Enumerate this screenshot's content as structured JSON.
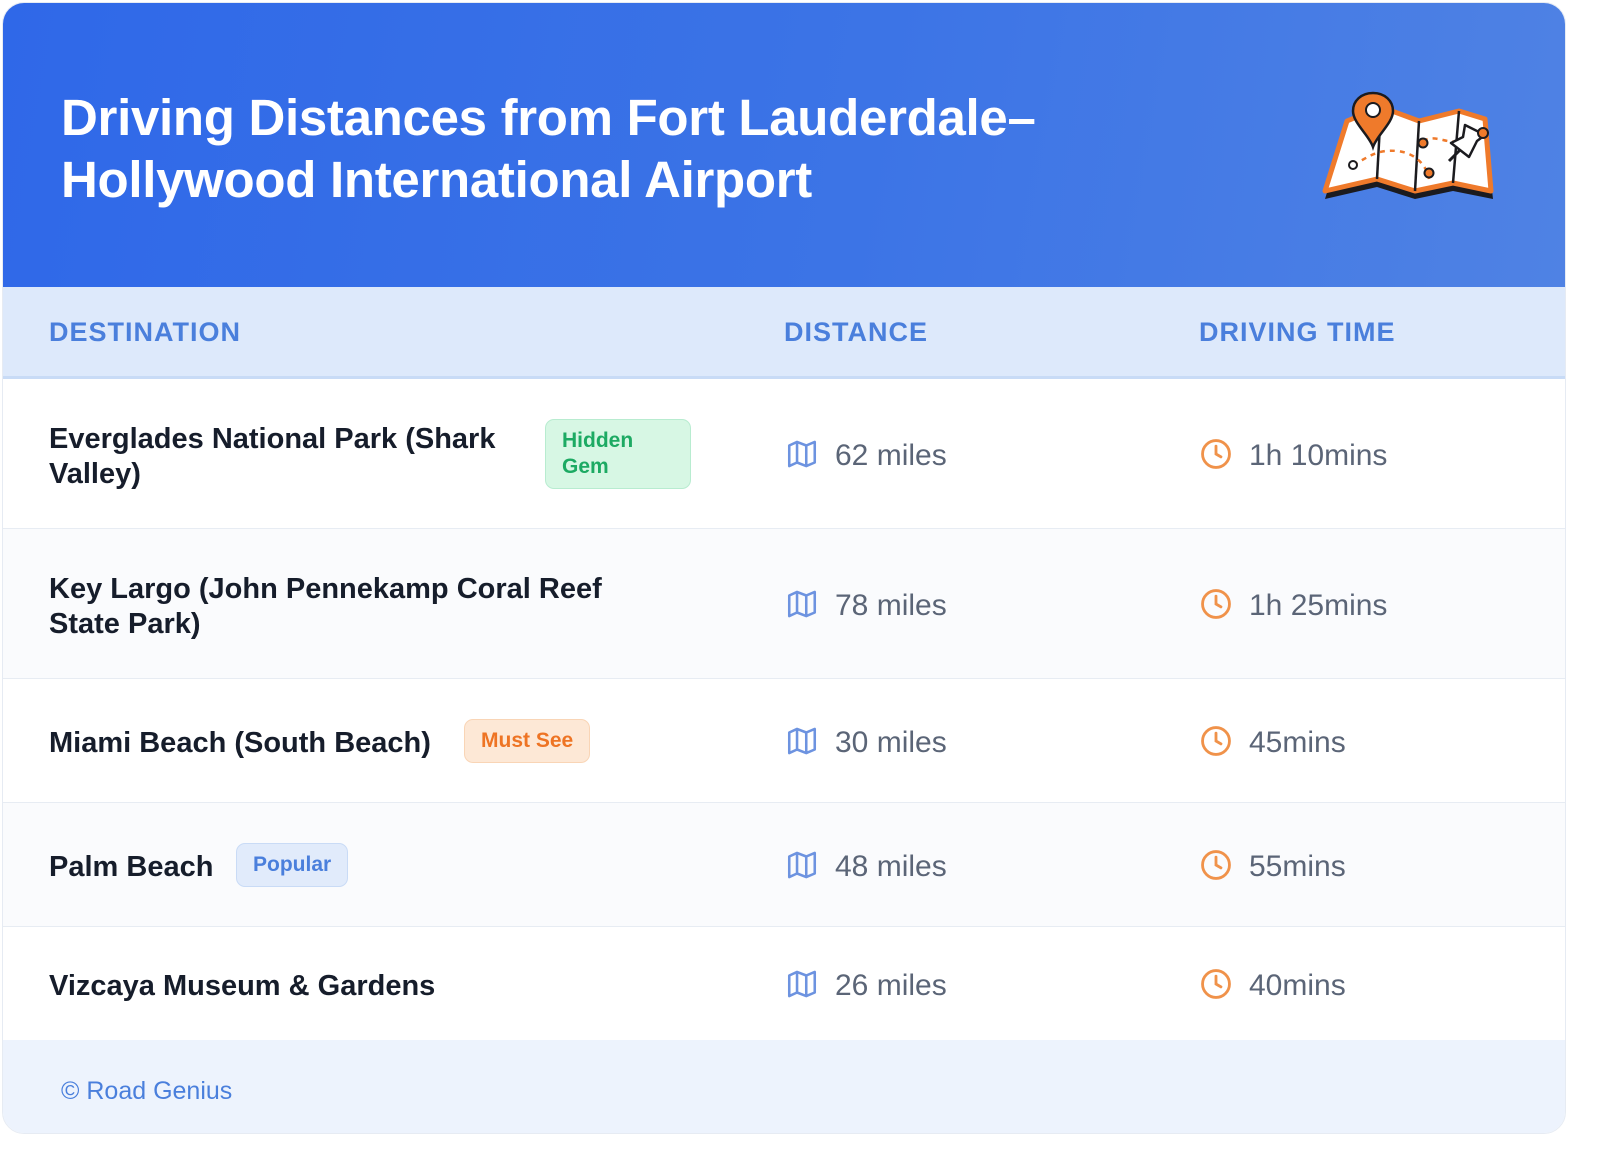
{
  "header": {
    "title": "Driving Distances from Fort Lauderdale–Hollywood International Airport",
    "icon": "folded-map-pin-icon"
  },
  "table": {
    "columns": [
      "DESTINATION",
      "DISTANCE",
      "DRIVING TIME"
    ],
    "rows": [
      {
        "destination": "Everglades National Park (Shark Valley)",
        "badge": "Hidden Gem",
        "badge_color": "#1daa63",
        "distance": "62 miles",
        "time": "1h 10mins"
      },
      {
        "destination": "Key Largo (John Pennekamp Coral Reef State Park)",
        "badge": "",
        "distance": "78 miles",
        "time": "1h 25mins"
      },
      {
        "destination": "Miami Beach (South Beach)",
        "badge": "Must See",
        "badge_color": "#ee7424",
        "distance": "30 miles",
        "time": "45mins"
      },
      {
        "destination": "Palm Beach",
        "badge": "Popular",
        "badge_color": "#4a7fdc",
        "distance": "48 miles",
        "time": "55mins"
      },
      {
        "destination": "Vizcaya Museum & Gardens",
        "badge": "",
        "distance": "26 miles",
        "time": "40mins"
      }
    ],
    "distance_icon": "map-icon",
    "time_icon": "clock-icon"
  },
  "footer": {
    "copyright": "© Road Genius"
  },
  "colors": {
    "header_bg": "#3068e6",
    "accent": "#4a7fdc",
    "clock": "#f0924a"
  }
}
